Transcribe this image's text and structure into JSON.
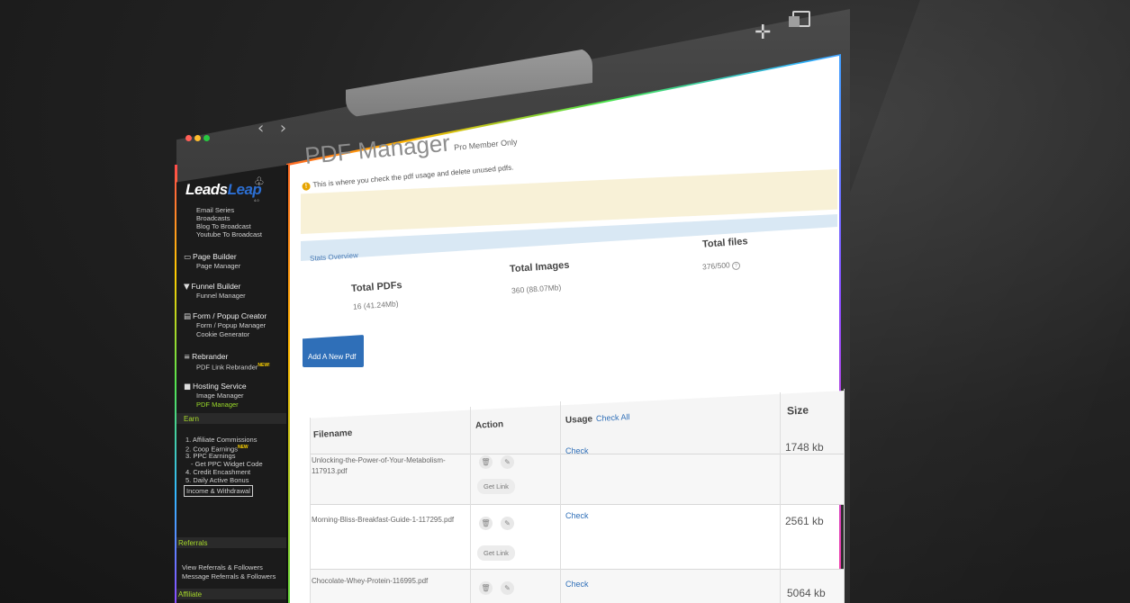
{
  "browser": {
    "nav_arrows": "‹ ›",
    "traffic_lights": [
      "#ff5f57",
      "#febc2e",
      "#28c840"
    ]
  },
  "sidebar": {
    "logo_main": "Leads",
    "logo_accent": "Leap",
    "logo_version": "4.0",
    "groups": {
      "email": {
        "items": [
          "Email Series",
          "Broadcasts",
          "Blog To Broadcast",
          "Youtube To Broadcast"
        ]
      },
      "page_builder": {
        "label": "Page Builder",
        "items": [
          "Page Manager"
        ]
      },
      "funnel_builder": {
        "label": "Funnel Builder",
        "items": [
          "Funnel Manager"
        ]
      },
      "form_popup": {
        "label": "Form / Popup Creator",
        "items": [
          "Form / Popup Manager",
          "Cookie Generator"
        ]
      },
      "rebrander": {
        "label": "Rebrander",
        "items": [
          "PDF Link Rebrander"
        ],
        "badge": "NEW!"
      },
      "hosting": {
        "label": "Hosting Service",
        "items": [
          "Image Manager",
          "PDF Manager"
        ]
      },
      "earn": {
        "label": "Earn",
        "items": [
          "1. Affiliate Commissions",
          "2. Coop Earnings",
          "3. PPC Earnings",
          "- Get PPC Widget Code",
          "4. Credit Encashment",
          "5. Daily Active Bonus"
        ],
        "coop_badge": "NEW",
        "boxed": "Income & Withdrawal"
      },
      "referrals": {
        "label": "Referrals",
        "items": [
          "View Referrals & Followers",
          "Message Referrals & Followers"
        ]
      },
      "affiliate": {
        "label": "Affiliate"
      }
    }
  },
  "page": {
    "title": "PDF Manager",
    "subtitle": "Pro Member Only",
    "notice": "This is where you check the pdf usage and delete unused pdfs."
  },
  "stats": {
    "label": "Stats Overview",
    "total_pdfs_label": "Total PDFs",
    "total_pdfs_value": "16 (41.24Mb)",
    "total_images_label": "Total Images",
    "total_images_value": "360 (88.07Mb)",
    "total_files_label": "Total files",
    "total_files_value": "376/500"
  },
  "add_button": "Add A New Pdf",
  "table": {
    "headers": {
      "filename": "Filename",
      "action": "Action",
      "usage": "Usage",
      "check_all": "Check All",
      "size": "Size"
    },
    "get_link_label": "Get Link",
    "check_label": "Check",
    "rows": [
      {
        "filename": "Unlocking-the-Power-of-Your-Metabolism-117913.pdf",
        "size": "1748 kb"
      },
      {
        "filename": "Morning-Bliss-Breakfast-Guide-1-117295.pdf",
        "size": "2561 kb"
      },
      {
        "filename": "Chocolate-Whey-Protein-116995.pdf",
        "size": "5064 kb"
      }
    ]
  }
}
